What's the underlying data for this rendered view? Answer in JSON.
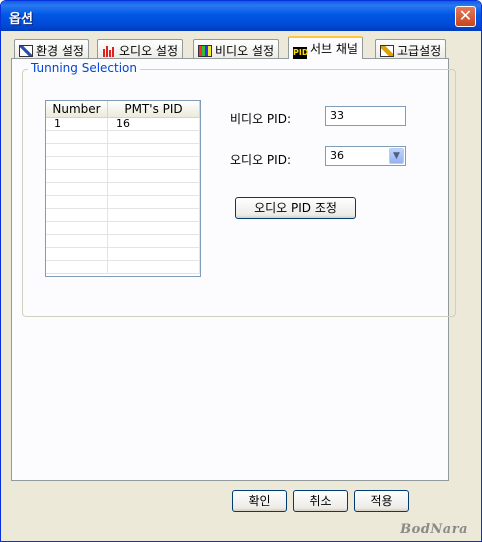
{
  "window": {
    "title": "옵션",
    "close_glyph": "✕"
  },
  "tabs": [
    {
      "label": "환경 설정",
      "icon": "environment-icon"
    },
    {
      "label": "오디오 설정",
      "icon": "audio-bars-icon"
    },
    {
      "label": "비디오 설정",
      "icon": "video-icon"
    },
    {
      "label": "서브 채널",
      "icon": "pid-icon",
      "icon_text": "PID",
      "active": true
    },
    {
      "label": "고급설정",
      "icon": "advanced-icon"
    }
  ],
  "tuning": {
    "group_label": "Tunning Selection",
    "columns": [
      "Number",
      "PMT's PID"
    ],
    "rows": [
      [
        "1",
        "16"
      ]
    ],
    "video_pid_label": "비디오 PID:",
    "video_pid_value": "33",
    "audio_pid_label": "오디오 PID:",
    "audio_pid_value": "36",
    "adjust_button": "오디오 PID 조정"
  },
  "footer": {
    "ok": "확인",
    "cancel": "취소",
    "apply": "적용"
  },
  "watermark": "BodNara"
}
